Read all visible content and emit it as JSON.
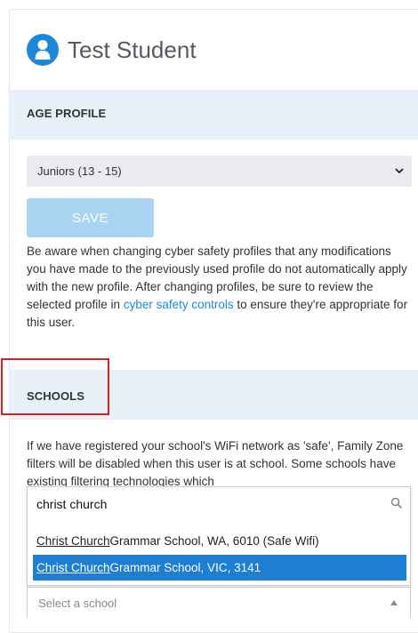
{
  "user": {
    "name": "Test Student",
    "avatar_icon": "user-icon"
  },
  "age_profile": {
    "title": "AGE PROFILE",
    "selected": "Juniors (13 - 15)",
    "save_label": "SAVE",
    "notice_before": "Be aware when changing cyber safety profiles that any modifications you have made to the previously used profile do not automatically apply with the new profile. After changing profiles, be sure to review the selected profile in ",
    "notice_link": "cyber safety controls",
    "notice_after": " to ensure they're appropriate for this user."
  },
  "schools": {
    "title": "SCHOOLS",
    "notice": "If we have registered your school's WiFi network as 'safe', Family Zone filters will be disabled when this user is at school. Some schools have existing filtering technologies which",
    "search_value": "christ church",
    "options": [
      {
        "match": "Christ Church",
        "rest": " Grammar School, WA, 6010 (Safe Wifi)"
      },
      {
        "match": "Christ Church",
        "rest": " Grammar School, VIC, 3141"
      }
    ],
    "select_placeholder": "Select a school"
  },
  "colors": {
    "accent": "#1e88d8",
    "section_bg": "#e8f1fa",
    "save_disabled": "#a9d4f2",
    "selected_option": "#1e7ed1",
    "highlight_border": "#e02020"
  }
}
